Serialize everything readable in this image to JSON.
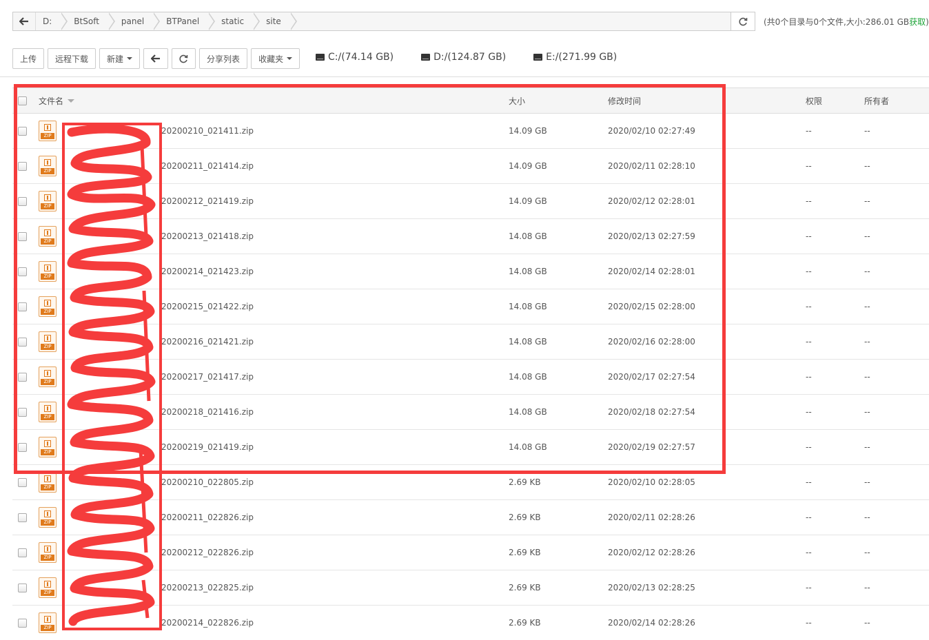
{
  "pathbar": {
    "crumbs": [
      "D:",
      "BtSoft",
      "panel",
      "BTPanel",
      "static",
      "site"
    ],
    "summary_text": "(共0个目录与0个文件,大小:286.01 GB",
    "summary_get": "获取",
    "summary_close": ")"
  },
  "toolbar": {
    "upload": "上传",
    "remote_download": "远程下载",
    "new": "新建",
    "share_list": "分享列表",
    "favorites": "收藏夹"
  },
  "disks": [
    {
      "label": "C:/(74.14 GB)"
    },
    {
      "label": "D:/(124.87 GB)"
    },
    {
      "label": "E:/(271.99 GB)"
    }
  ],
  "table": {
    "headers": {
      "name": "文件名",
      "size": "大小",
      "time": "修改时间",
      "perm": "权限",
      "owner": "所有者"
    },
    "zip_tag": "ZIP",
    "rows": [
      {
        "name": "20200210_021411.zip",
        "size": "14.09 GB",
        "time": "2020/02/10 02:27:49",
        "perm": "--",
        "owner": "--"
      },
      {
        "name": "20200211_021414.zip",
        "size": "14.09 GB",
        "time": "2020/02/11 02:28:10",
        "perm": "--",
        "owner": "--"
      },
      {
        "name": "20200212_021419.zip",
        "size": "14.09 GB",
        "time": "2020/02/12 02:28:01",
        "perm": "--",
        "owner": "--"
      },
      {
        "name": "20200213_021418.zip",
        "size": "14.08 GB",
        "time": "2020/02/13 02:27:59",
        "perm": "--",
        "owner": "--"
      },
      {
        "name": "20200214_021423.zip",
        "size": "14.08 GB",
        "time": "2020/02/14 02:28:01",
        "perm": "--",
        "owner": "--"
      },
      {
        "name": "20200215_021422.zip",
        "size": "14.08 GB",
        "time": "2020/02/15 02:28:00",
        "perm": "--",
        "owner": "--"
      },
      {
        "name": "20200216_021421.zip",
        "size": "14.08 GB",
        "time": "2020/02/16 02:28:00",
        "perm": "--",
        "owner": "--"
      },
      {
        "name": "20200217_021417.zip",
        "size": "14.08 GB",
        "time": "2020/02/17 02:27:54",
        "perm": "--",
        "owner": "--"
      },
      {
        "name": "20200218_021416.zip",
        "size": "14.08 GB",
        "time": "2020/02/18 02:27:54",
        "perm": "--",
        "owner": "--"
      },
      {
        "name": "20200219_021419.zip",
        "size": "14.08 GB",
        "time": "2020/02/19 02:27:57",
        "perm": "--",
        "owner": "--"
      },
      {
        "name": "20200210_022805.zip",
        "size": "2.69 KB",
        "time": "2020/02/10 02:28:05",
        "perm": "--",
        "owner": "--"
      },
      {
        "name": "20200211_022826.zip",
        "size": "2.69 KB",
        "time": "2020/02/11 02:28:26",
        "perm": "--",
        "owner": "--"
      },
      {
        "name": "20200212_022826.zip",
        "size": "2.69 KB",
        "time": "2020/02/12 02:28:26",
        "perm": "--",
        "owner": "--"
      },
      {
        "name": "20200213_022825.zip",
        "size": "2.69 KB",
        "time": "2020/02/13 02:28:25",
        "perm": "--",
        "owner": "--"
      },
      {
        "name": "20200214_022826.zip",
        "size": "2.69 KB",
        "time": "2020/02/14 02:28:26",
        "perm": "--",
        "owner": "--"
      }
    ]
  },
  "colors": {
    "accent_green": "#20a53a",
    "annotation_red": "#f53c3c",
    "zip_orange": "#e07a1b"
  }
}
